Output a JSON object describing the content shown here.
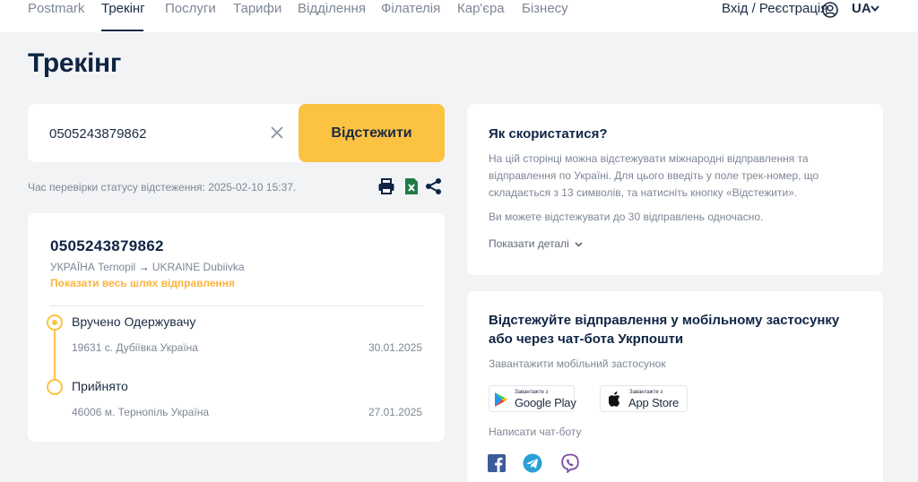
{
  "nav": {
    "items": [
      {
        "label": "Postmark"
      },
      {
        "label": "Трекінг"
      },
      {
        "label": "Послуги"
      },
      {
        "label": "Тарифи"
      },
      {
        "label": "Відділення"
      },
      {
        "label": "Філателія"
      },
      {
        "label": "Кар'єра"
      },
      {
        "label": "Бізнесу"
      }
    ],
    "active_index": 1,
    "login_label": "Вхід / Реєстрація",
    "language": "UA"
  },
  "page": {
    "title": "Трекінг"
  },
  "search": {
    "value": "0505243879862",
    "button_label": "Відстежити"
  },
  "status": {
    "check_time": "Час перевірки статусу відстеження: 2025-02-10 15:37."
  },
  "result": {
    "tracking_number": "0505243879862",
    "route_from": "УКРАЇНА Ternopil",
    "route_to": "UKRAINE Dubiivka",
    "show_full_path": "Показати весь шлях відправлення",
    "events": [
      {
        "status": "Вручено Одержувачу",
        "location": "19631 с. Дубіївка Україна",
        "date": "30.01.2025"
      },
      {
        "status": "Прийнято",
        "location": "46006 м. Тернопіль Україна",
        "date": "27.01.2025"
      }
    ]
  },
  "howto": {
    "title": "Як скористатися?",
    "text": "На цій сторінці можна відстежувати міжнародні відправлення та відправлення по Україні. Для цього введіть у поле трек-номер, що складається з 13 символів, та натисніть кнопку «Відстежити».",
    "limit_text": "Ви можете відстежувати до 30 відправлень одночасно.",
    "details_link": "Показати деталі"
  },
  "app": {
    "title": "Відстежуйте відправлення у мобільному застосунку або через чат-бота Укрпошти",
    "download_label": "Завантажити мобільний застосунок",
    "google_play_small": "Завантажте з",
    "google_play_big": "Google Play",
    "app_store_small": "Завантажте з",
    "app_store_big": "App Store",
    "chat_label": "Написати чат-боту"
  },
  "colors": {
    "accent": "#fcc242",
    "link_orange": "#fcb53b",
    "title_navy": "#0f2444",
    "background": "#f2f3f5"
  },
  "icons": [
    "user-circle-icon",
    "chevron-down-icon",
    "clear-icon",
    "print-icon",
    "excel-icon",
    "share-icon",
    "play-store-icon",
    "apple-icon",
    "facebook-icon",
    "telegram-icon",
    "viber-icon"
  ]
}
